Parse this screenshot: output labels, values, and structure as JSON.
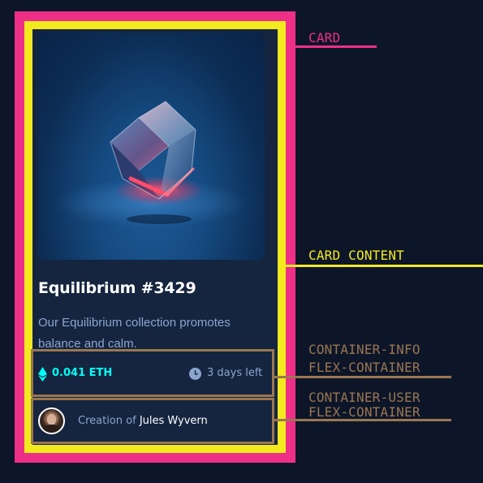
{
  "colors": {
    "page_background": "#0d1629",
    "card_outline": "#ee2f88",
    "card_content_outline": "#f3e91f",
    "flex_container_outline": "#9a7651",
    "card_background": "#15253f",
    "accent_cyan": "#00fff8",
    "muted_text": "#8ba6cf"
  },
  "card": {
    "image": {
      "subject": "glowing glass cube"
    },
    "title": "Equilibrium #3429",
    "description": "Our Equilibrium collection promotes balance and calm.",
    "info": {
      "price": "0.041 ETH",
      "time_left": "3 days left",
      "icons": [
        "ethereum-icon",
        "clock-icon"
      ]
    },
    "user": {
      "creation_prefix": "Creation of",
      "creator_name": "Jules Wyvern"
    }
  },
  "annotations": {
    "card": "CARD",
    "card_content": "CARD CONTENT",
    "container_info": [
      "CONTAINER-INFO",
      "FLEX-CONTAINER"
    ],
    "container_user": [
      "CONTAINER-USER",
      "FLEX-CONTAINER"
    ]
  }
}
